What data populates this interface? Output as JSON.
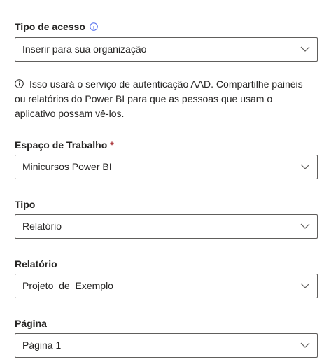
{
  "access": {
    "label": "Tipo de acesso",
    "value": "Inserir para sua organização"
  },
  "info_message": "Isso usará o serviço de autenticação AAD. Compartilhe painéis ou relatórios do Power BI para que as pessoas que usam o aplicativo possam vê-los.",
  "workspace": {
    "label": "Espaço de Trabalho",
    "required_mark": "*",
    "value": "Minicursos Power BI"
  },
  "type": {
    "label": "Tipo",
    "value": "Relatório"
  },
  "report": {
    "label": "Relatório",
    "value": "Projeto_de_Exemplo"
  },
  "page": {
    "label": "Página",
    "value": "Página 1"
  },
  "colors": {
    "accent": "#4f6bed",
    "required": "#a4262c",
    "border": "#605e5c",
    "text": "#252423"
  }
}
